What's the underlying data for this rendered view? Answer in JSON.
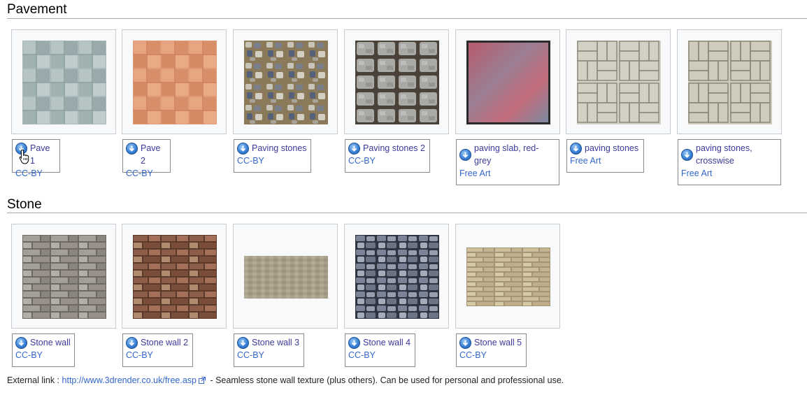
{
  "sections": [
    {
      "title": "Pavement",
      "items": [
        {
          "title": "Pave 1",
          "license": "CC-BY"
        },
        {
          "title": "Pave 2",
          "license": "CC-BY"
        },
        {
          "title": "Paving stones",
          "license": "CC-BY"
        },
        {
          "title": "Paving stones 2",
          "license": "CC-BY"
        },
        {
          "title_line1": "paving slab, red-",
          "title_line2": "grey",
          "license": "Free Art"
        },
        {
          "title": "paving stones",
          "license": "Free Art"
        },
        {
          "title_line1": "paving stones,",
          "title_line2": "crosswise",
          "license": "Free Art"
        }
      ]
    },
    {
      "title": "Stone",
      "items": [
        {
          "title": "Stone wall",
          "license": "CC-BY"
        },
        {
          "title": "Stone wall 2",
          "license": "CC-BY"
        },
        {
          "title": "Stone wall 3",
          "license": "CC-BY"
        },
        {
          "title": "Stone wall 4",
          "license": "CC-BY"
        },
        {
          "title": "Stone wall 5",
          "license": "CC-BY"
        }
      ]
    }
  ],
  "footer": {
    "prefix": "External link : ",
    "link_text": "http://www.3drender.co.uk/free.asp",
    "suffix": " - Seamless stone wall texture (plus others). Can be used for personal and professional use."
  },
  "icons": {
    "download": "download-circle-icon",
    "external": "external-link-icon",
    "cursor": "hand-pointer-icon"
  },
  "colors": {
    "link": "#3366cc",
    "title_link": "#3a3a9a",
    "rule": "#a2a9b1",
    "thumb_bg": "#f8f9fa"
  }
}
